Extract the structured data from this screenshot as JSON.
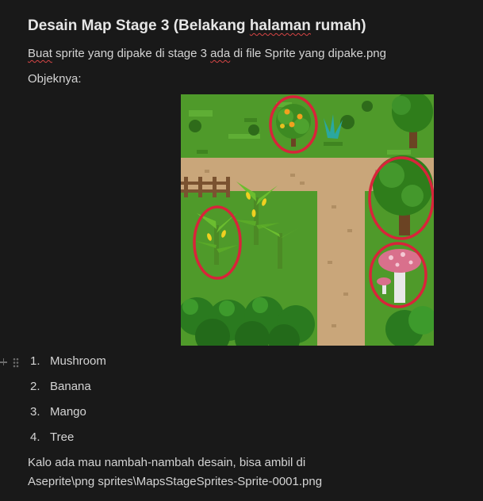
{
  "heading": {
    "title_before": "Desain Map Stage 3 (Belakang ",
    "title_misspelled": "halaman",
    "title_after": " rumah)"
  },
  "intro": {
    "word1": "Buat",
    "middle": " sprite yang dipake di stage 3 ",
    "word2": "ada",
    "end": " di file Sprite yang dipake.png"
  },
  "objects_label": "Objeknya:",
  "image": {
    "description_name": "map-stage-3-screenshot",
    "colors": {
      "grass": "#4f9a2a",
      "path": "#c9a67a",
      "highlight_circle": "#d8243a",
      "mushroom_cap": "#d9708c",
      "banana": "#f0d020"
    }
  },
  "list": {
    "items": [
      {
        "num": "1.",
        "label": "Mushroom"
      },
      {
        "num": "2.",
        "label": "Banana"
      },
      {
        "num": "3.",
        "label": "Mango"
      },
      {
        "num": "4.",
        "label": "Tree"
      }
    ]
  },
  "footer": {
    "line1": "Kalo ada mau nambah-nambah desain, bisa ambil di",
    "line2": "Aseprite\\png sprites\\MapsStageSprites-Sprite-0001.png"
  }
}
